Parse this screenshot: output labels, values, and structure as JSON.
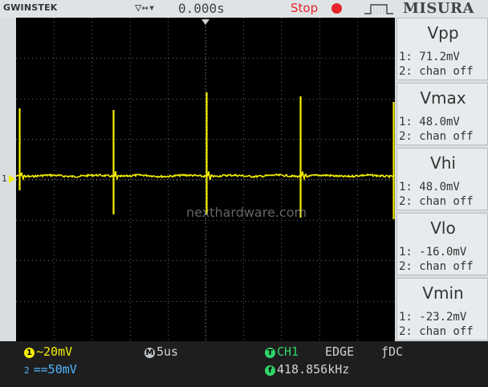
{
  "header": {
    "brand": "GWINSTEK",
    "trigger_icon_text": "▽↔▾",
    "time_position": "0.000s",
    "run_state": "Stop",
    "menu_title": "MISURA"
  },
  "waveform": {
    "channel_marker": "1",
    "watermark": "nexthardware.com",
    "grid_divisions": {
      "horizontal": 10,
      "vertical": 8
    },
    "trace_color": "#f5ef00"
  },
  "measurements": [
    {
      "title": "Vpp",
      "line1": "1: 71.2mV",
      "line2": "2: chan off"
    },
    {
      "title": "Vmax",
      "line1": "1: 48.0mV",
      "line2": "2: chan off"
    },
    {
      "title": "Vhi",
      "line1": "1: 48.0mV",
      "line2": "2: chan off"
    },
    {
      "title": "Vlo",
      "line1": "1: -16.0mV",
      "line2": "2: chan off"
    },
    {
      "title": "Vmin",
      "line1": "1: -23.2mV",
      "line2": "2: chan off"
    }
  ],
  "footer": {
    "ch1_badge": "1",
    "ch1_scale": "~20mV",
    "ch2_badge": "2",
    "ch2_scale": "==50mV",
    "timebase_badge": "M",
    "timebase": "5us",
    "trigger_badge": "T",
    "trigger_source": "CH1",
    "trigger_type": "EDGE",
    "coupling": "ƒDC",
    "freq_badge": "f",
    "frequency": "418.856kHz"
  },
  "colors": {
    "ch1": "#f5ef00",
    "ch2": "#4fb6ff",
    "stop": "#e5252a",
    "trigger": "#2fd46a"
  }
}
